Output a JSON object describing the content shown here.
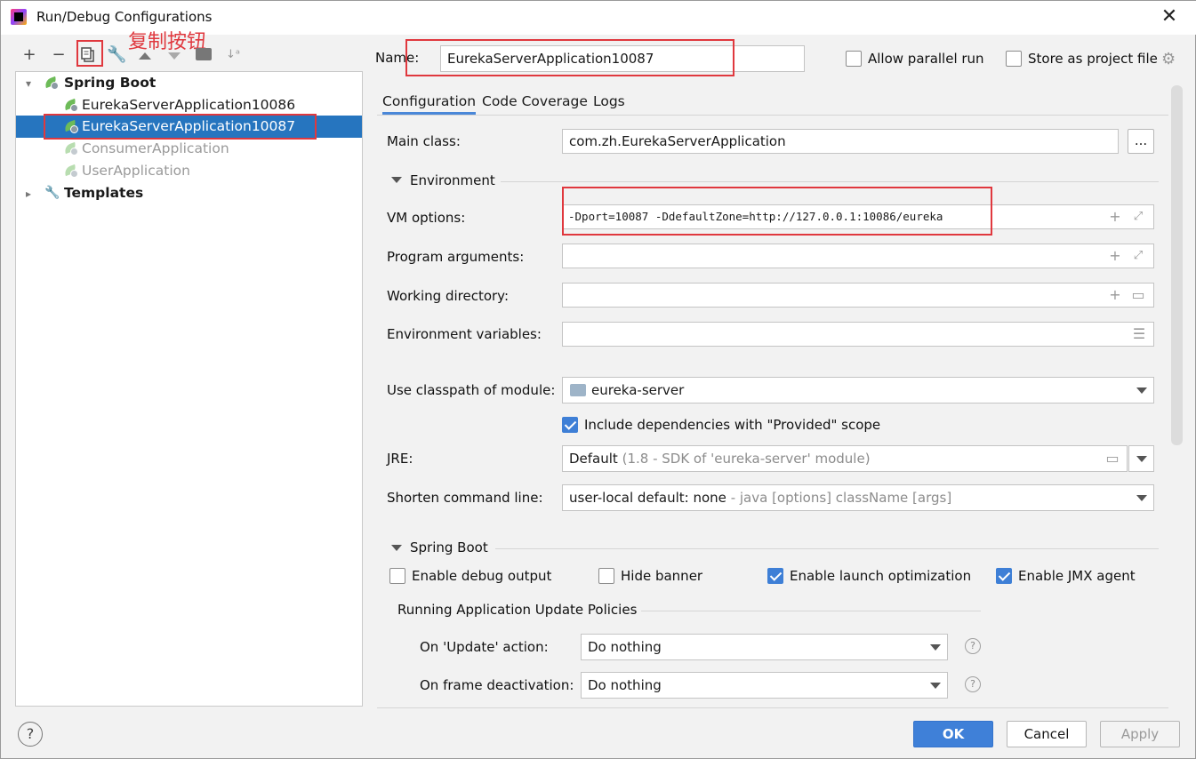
{
  "window": {
    "title": "Run/Debug Configurations"
  },
  "annotation": {
    "text": "复制按钮"
  },
  "tree": {
    "group_spring": "Spring Boot",
    "items": [
      {
        "label": "EurekaServerApplication10086"
      },
      {
        "label": "EurekaServerApplication10087"
      },
      {
        "label": "ConsumerApplication"
      },
      {
        "label": "UserApplication"
      }
    ],
    "group_templates": "Templates"
  },
  "name_row": {
    "label": "Name:",
    "value": "EurekaServerApplication10087",
    "allow_parallel": "Allow parallel run",
    "store_project": "Store as project file"
  },
  "tabs": [
    "Configuration",
    "Code Coverage",
    "Logs"
  ],
  "main_class": {
    "label": "Main class:",
    "value": "com.zh.EurekaServerApplication",
    "browse": "..."
  },
  "environment": {
    "section": "Environment",
    "vm_label": "VM options:",
    "vm_value": "-Dport=10087 -DdefaultZone=http://127.0.0.1:10086/eureka",
    "program_label": "Program arguments:",
    "workdir_label": "Working directory:",
    "envvars_label": "Environment variables:"
  },
  "classpath": {
    "label": "Use classpath of module:",
    "value": "eureka-server"
  },
  "include_provided": "Include dependencies with \"Provided\" scope",
  "jre": {
    "label": "JRE:",
    "value": "Default",
    "hint": "(1.8 - SDK of 'eureka-server' module)"
  },
  "shorten": {
    "label": "Shorten command line:",
    "value": "user-local default: none",
    "hint": "- java [options] className [args]"
  },
  "spring_boot": {
    "section": "Spring Boot",
    "debug_output": "Enable debug output",
    "hide_banner": "Hide banner",
    "launch_opt": "Enable launch optimization",
    "jmx": "Enable JMX agent",
    "policies": "Running Application Update Policies",
    "update_label": "On 'Update' action:",
    "update_value": "Do nothing",
    "frame_label": "On frame deactivation:",
    "frame_value": "Do nothing"
  },
  "buttons": {
    "ok": "OK",
    "cancel": "Cancel",
    "apply": "Apply",
    "help": "?"
  },
  "colors": {
    "accent": "#3f80d8",
    "selection": "#2675bf",
    "annotation": "#e0383e"
  }
}
